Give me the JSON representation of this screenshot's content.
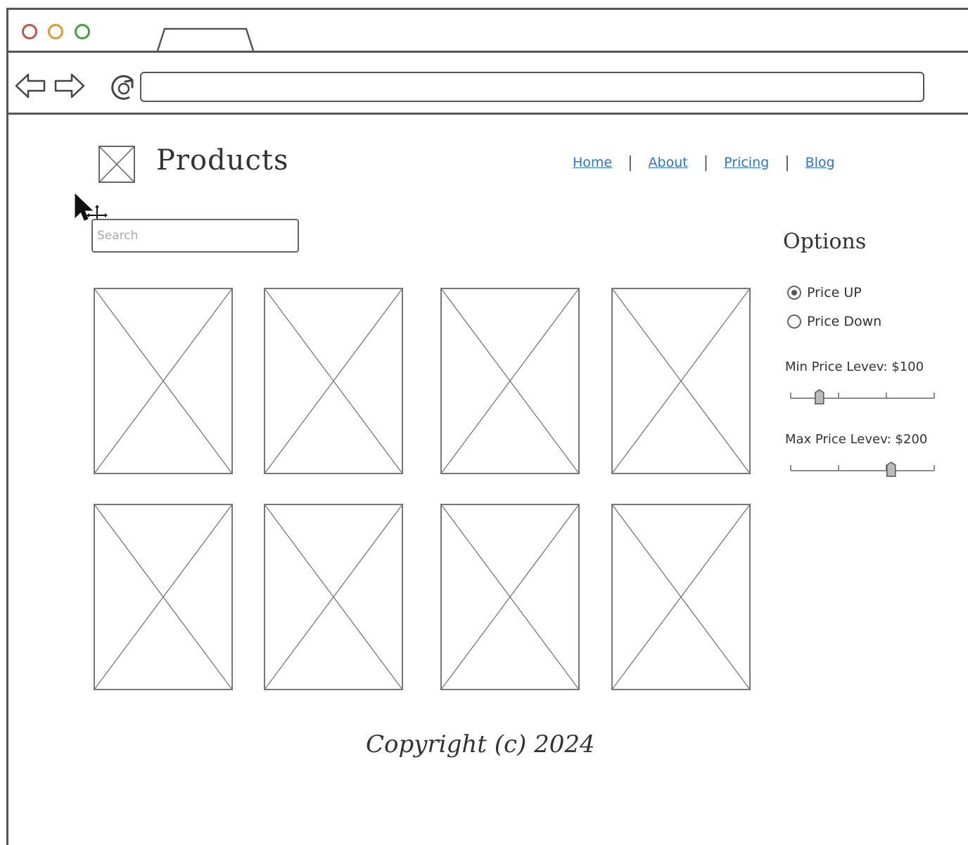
{
  "header": {
    "title": "Products"
  },
  "nav": {
    "home": "Home",
    "about": "About",
    "pricing": "Pricing",
    "blog": "Blog"
  },
  "search": {
    "placeholder": "Search"
  },
  "options": {
    "title": "Options",
    "radio_up": "Price UP",
    "radio_down": "Price Down",
    "selected": "Price UP",
    "min_label": "Min Price Levev: $100",
    "max_label": "Max Price Levev: $200",
    "min_level": 0.2,
    "max_level": 0.7
  },
  "footer": {
    "copyright": "Copyright (c) 2024"
  },
  "colors": {
    "link": "#2f74c6",
    "close": "#c9504a",
    "minimize": "#e19a2c",
    "maximize": "#3fa33a"
  }
}
